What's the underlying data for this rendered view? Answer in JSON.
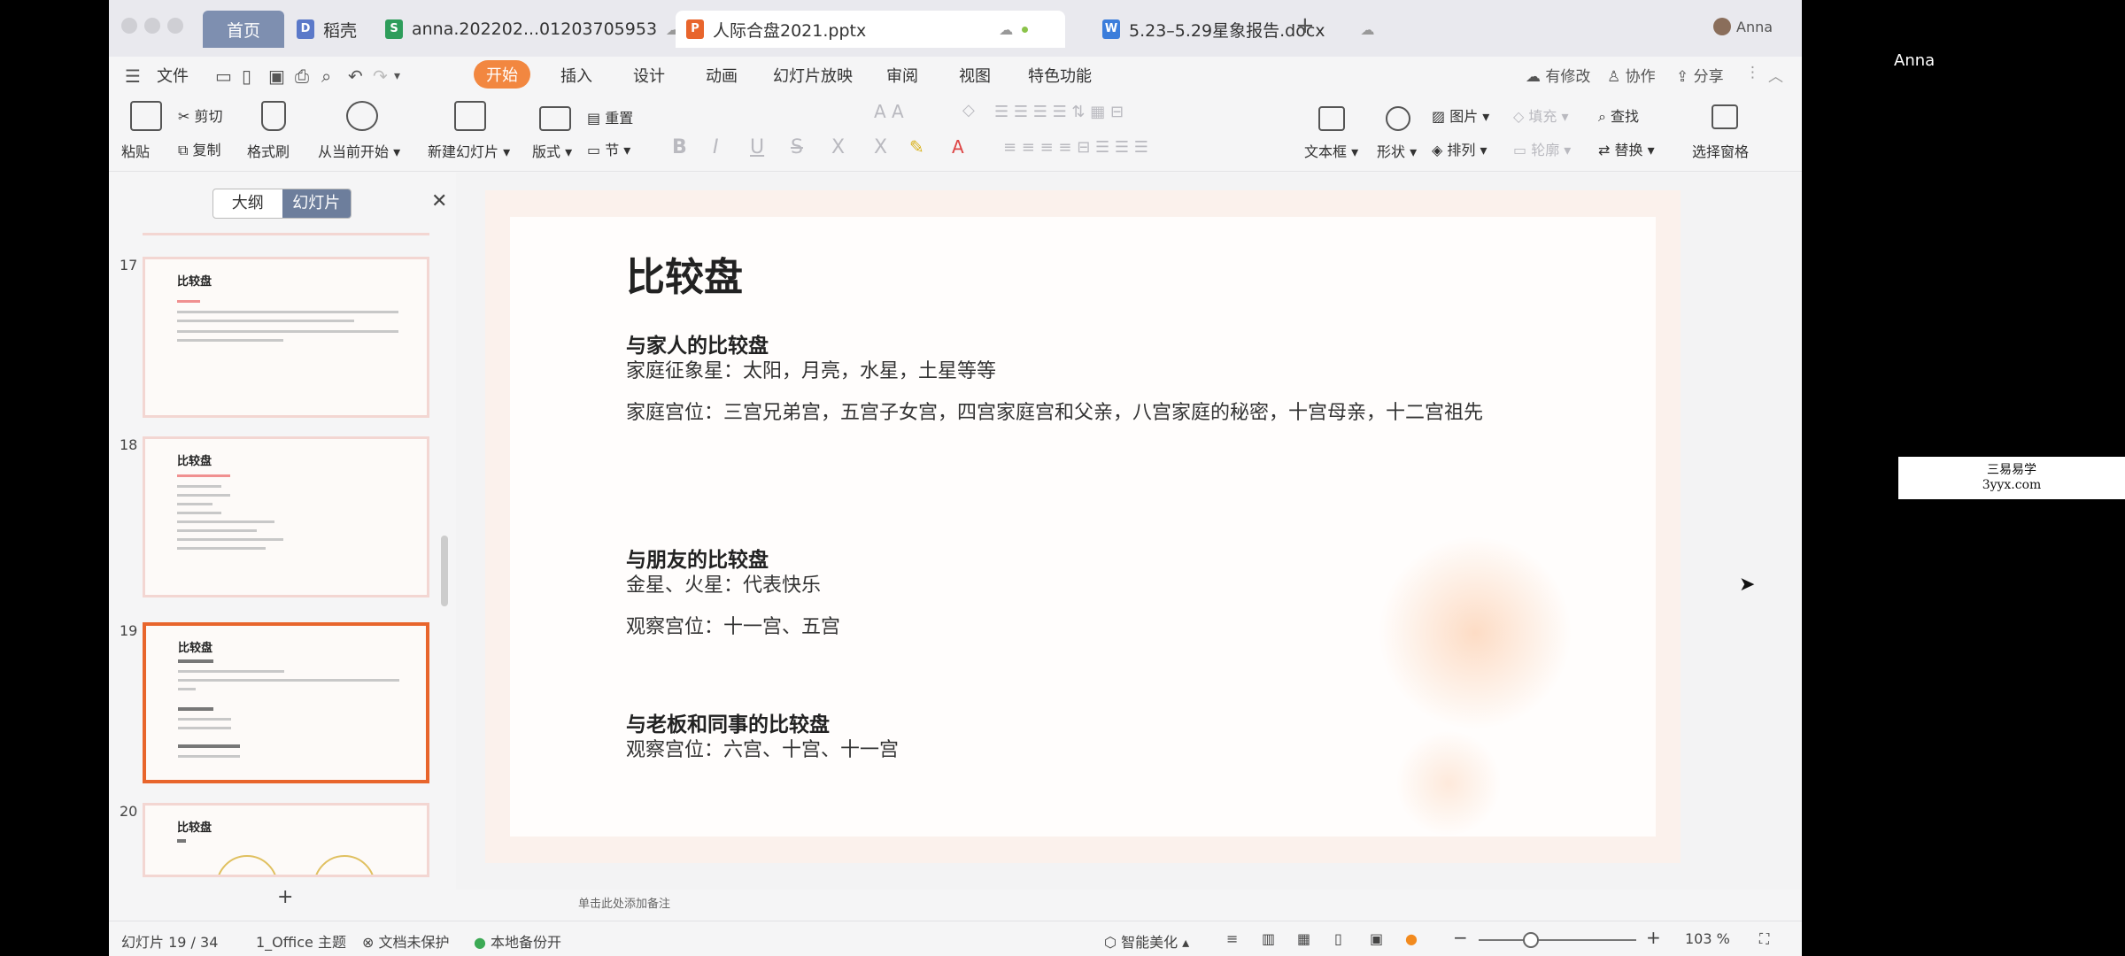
{
  "tabs": [
    {
      "label": "首页"
    },
    {
      "label": "稻壳"
    },
    {
      "label": "anna.202202...01203705953"
    },
    {
      "label": "人际合盘2021.pptx"
    },
    {
      "label": "5.23–5.29星象报告.docx"
    }
  ],
  "user": {
    "name": "Anna",
    "outside_name": "Anna"
  },
  "menu": {
    "file": "文件",
    "items": [
      "开始",
      "插入",
      "设计",
      "动画",
      "幻灯片放映",
      "审阅",
      "视图",
      "特色功能"
    ],
    "right": {
      "modified": "有修改",
      "collab": "协作",
      "share": "分享"
    }
  },
  "ribbon": {
    "paste": "粘贴",
    "cut": "剪切",
    "copy": "复制",
    "format_painter": "格式刷",
    "play_from_current": "从当前开始",
    "new_slide": "新建幻灯片",
    "layout": "版式",
    "reset": "重置",
    "section": "节",
    "textbox": "文本框",
    "shape": "形状",
    "picture": "图片",
    "arrange": "排列",
    "fill": "填充",
    "outline": "轮廓",
    "find": "查找",
    "replace": "替换",
    "select_pane": "选择窗格"
  },
  "left_panel": {
    "outline_tab": "大纲",
    "slides_tab": "幻灯片",
    "thumbnails": [
      {
        "num": "17",
        "title": "比较盘"
      },
      {
        "num": "18",
        "title": "比较盘"
      },
      {
        "num": "19",
        "title": "比较盘"
      },
      {
        "num": "20",
        "title": "比较盘"
      }
    ]
  },
  "slide": {
    "title": "比较盘",
    "sections": [
      {
        "heading": "与家人的比较盘",
        "lines": [
          "家庭征象星：太阳，月亮，水星，土星等等",
          "家庭宫位：三宫兄弟宫，五宫子女宫，四宫家庭宫和父亲，八宫家庭的秘密，十宫母亲，十二宫祖先"
        ]
      },
      {
        "heading": "与朋友的比较盘",
        "lines": [
          "金星、火星：代表快乐",
          "观察宫位：十一宫、五宫"
        ]
      },
      {
        "heading": "与老板和同事的比较盘",
        "lines": [
          "观察宫位：六宫、十宫、十一宫"
        ]
      }
    ]
  },
  "notes_placeholder": "单击此处添加备注",
  "status": {
    "slide_counter": "幻灯片 19 / 34",
    "theme": "1_Office 主题",
    "protection": "文档未保护",
    "backup": "本地备份开",
    "beautify": "智能美化",
    "zoom": "103 %",
    "zoom_fraction": 0.33
  },
  "watermark": {
    "line1": "三易易学",
    "line2": "3yyx.com"
  },
  "colors": {
    "accent": "#f28740",
    "selected_border": "#e8652c",
    "home_tab": "#7e8fb0"
  }
}
